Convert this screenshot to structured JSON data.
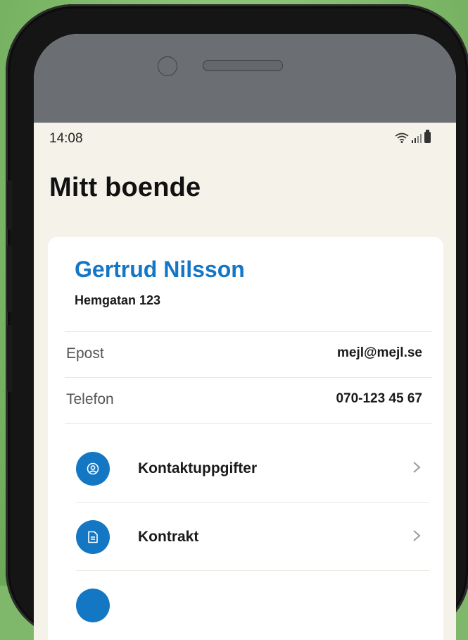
{
  "status_bar": {
    "time": "14:08",
    "icons": [
      "wifi-icon",
      "signal-icon",
      "battery-icon"
    ]
  },
  "page": {
    "title": "Mitt boende"
  },
  "profile": {
    "name": "Gertrud Nilsson",
    "address": "Hemgatan 123",
    "email_label": "Epost",
    "email_value": "mejl@mejl.se",
    "phone_label": "Telefon",
    "phone_value": "070-123 45 67"
  },
  "menu": {
    "items": [
      {
        "label": "Kontaktuppgifter",
        "icon": "user-circle-icon"
      },
      {
        "label": "Kontrakt",
        "icon": "document-icon"
      },
      {
        "label": "",
        "icon": ""
      }
    ]
  },
  "colors": {
    "accent": "#1476c6",
    "background": "#f5f2ea",
    "card": "#ffffff",
    "backdrop": "#7fb86a"
  }
}
